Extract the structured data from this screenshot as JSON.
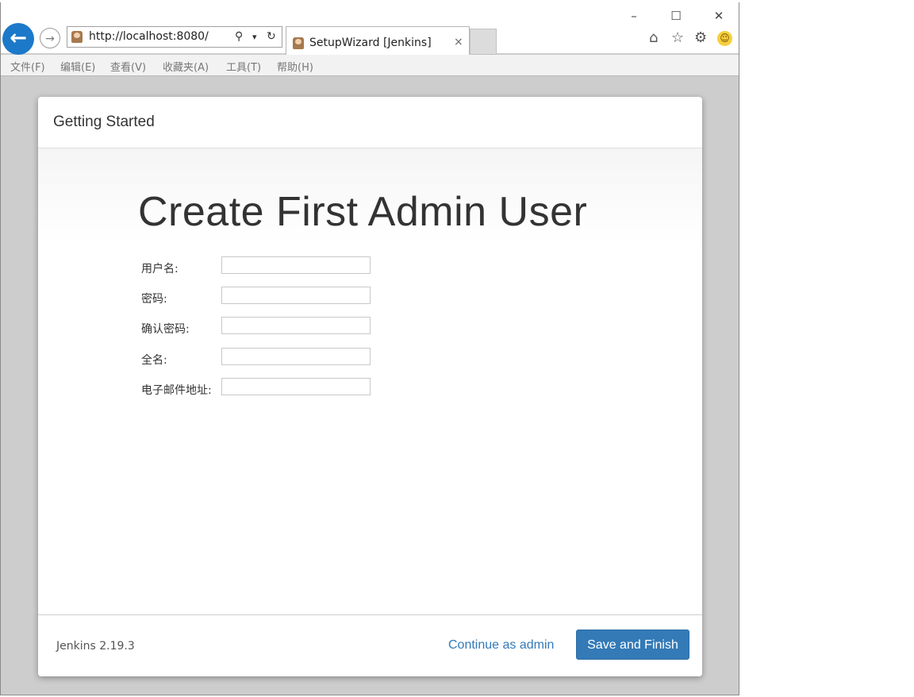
{
  "browser": {
    "window_controls": {
      "minimize": "–",
      "maximize": "☐",
      "close": "✕"
    },
    "address": {
      "url": "http://localhost:8080/",
      "search_icon": "⚲",
      "dropdown_icon": "▾",
      "refresh_icon": "↻"
    },
    "tab": {
      "title": "SetupWizard [Jenkins]",
      "close": "×"
    },
    "toolbar_icons": {
      "home": "⌂",
      "star": "☆",
      "gear": "⚙",
      "smiley": "☺"
    },
    "menu": [
      "文件(F)",
      "编辑(E)",
      "查看(V)",
      "收藏夹(A)",
      "工具(T)",
      "帮助(H)"
    ]
  },
  "dialog": {
    "header_title": "Getting Started",
    "title": "Create First Admin User",
    "fields": [
      {
        "label": "用户名:",
        "value": ""
      },
      {
        "label": "密码:",
        "value": ""
      },
      {
        "label": "确认密码:",
        "value": ""
      },
      {
        "label": "全名:",
        "value": ""
      },
      {
        "label": "电子邮件地址:",
        "value": ""
      }
    ],
    "footer": {
      "version": "Jenkins 2.19.3",
      "continue_label": "Continue as admin",
      "save_label": "Save and Finish"
    }
  },
  "icons": {
    "back": "back-arrow-icon",
    "forward": "forward-arrow-icon"
  },
  "colors": {
    "accent": "#337ab7",
    "back_button": "#1c79c9"
  }
}
